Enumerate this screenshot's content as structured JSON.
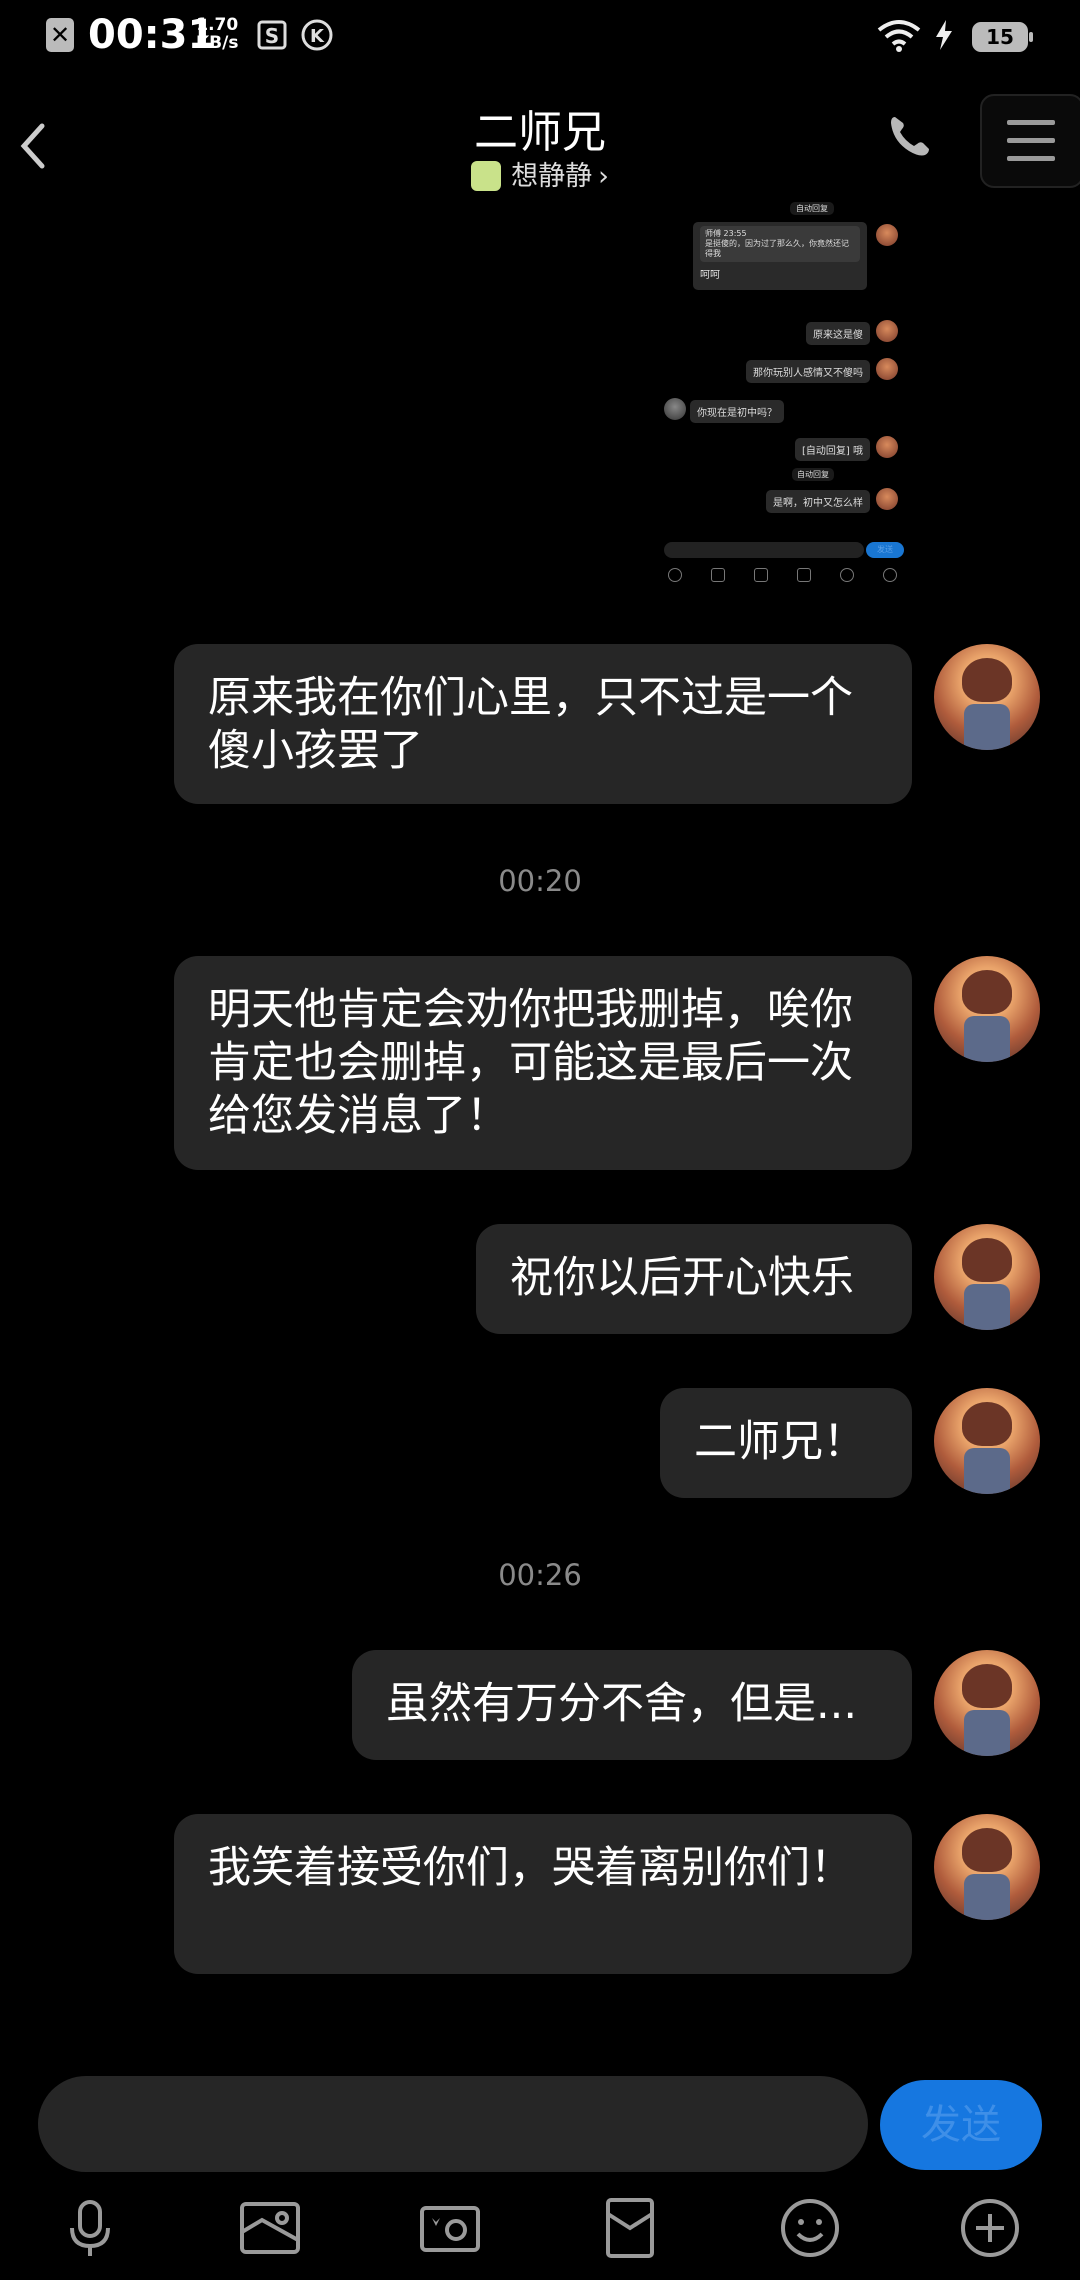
{
  "status_bar": {
    "time": "00:31",
    "speed_value": "1.70",
    "speed_unit": "KB/s",
    "battery": "15"
  },
  "header": {
    "title": "二师兄",
    "subtitle": "想静静",
    "subtitle_arrow": "›"
  },
  "embedded_screenshot": {
    "top_label": "自动回复",
    "quote_name": "师傅 23:55",
    "quote_text": "是挺傻的，因为过了那么久，你竟然还记得我",
    "quote_reply": "呵呵",
    "messages": [
      {
        "text": "原来这是傻"
      },
      {
        "text": "那你玩别人感情又不傻吗"
      },
      {
        "text": "你现在是初中吗？"
      },
      {
        "text": "[自动回复] 哦"
      },
      {
        "text": "自动回复"
      },
      {
        "text": "是啊，初中又怎么样"
      }
    ],
    "send_label": "发送"
  },
  "messages": [
    {
      "text": "原来我在你们心里，只不过是一个傻小孩罢了"
    },
    {
      "timestamp": "00:20"
    },
    {
      "text": "明天他肯定会劝你把我删掉，唉你肯定也会删掉，可能这是最后一次给您发消息了！"
    },
    {
      "text": "祝你以后开心快乐"
    },
    {
      "text": "二师兄！"
    },
    {
      "timestamp": "00:26"
    },
    {
      "text": "虽然有万分不舍，但是..."
    },
    {
      "text": "我笑着接受你们，哭着离别你们！"
    }
  ],
  "input": {
    "placeholder": "",
    "send_label": "发送"
  },
  "toolbar": [
    "microphone-icon",
    "image-icon",
    "camera-icon",
    "red-packet-icon",
    "emoji-icon",
    "plus-icon"
  ],
  "colors": {
    "bubble": "#262626",
    "send": "#1677e0",
    "background": "#000000"
  }
}
